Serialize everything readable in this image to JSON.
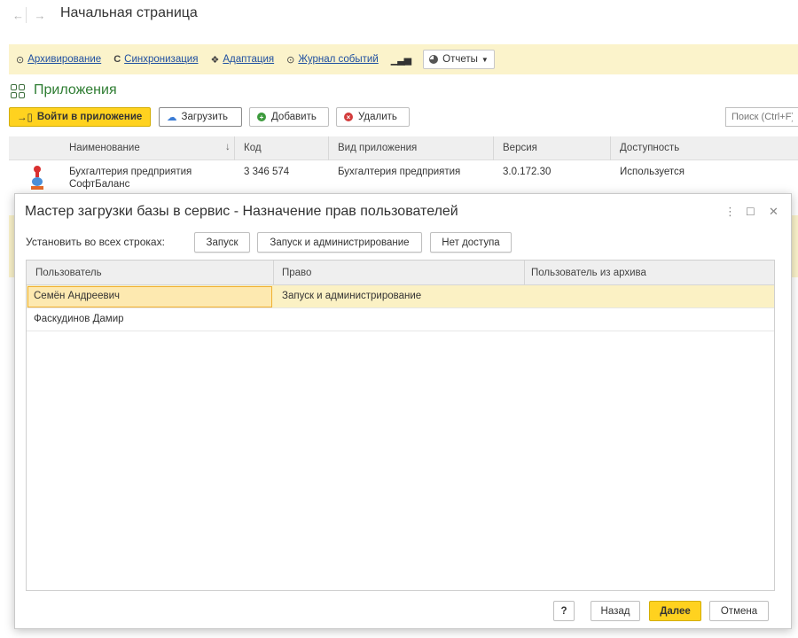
{
  "window": {
    "title": "Начальная страница"
  },
  "commands": [
    {
      "icon": "clock-icon",
      "glyph": "⊙",
      "label": "Архивирование"
    },
    {
      "icon": "refresh-icon",
      "glyph": "C",
      "label": "Синхронизация"
    },
    {
      "icon": "puzzle-icon",
      "glyph": "❖",
      "label": "Адаптация"
    },
    {
      "icon": "history-icon",
      "glyph": "⊙",
      "label": "Журнал событий"
    }
  ],
  "reports": {
    "label": "Отчеты"
  },
  "section": {
    "title": "Приложения"
  },
  "toolbar": {
    "login": "Войти в приложение",
    "upload": "Загрузить",
    "add": "Добавить",
    "delete": "Удалить",
    "search_placeholder": "Поиск (Ctrl+F)"
  },
  "apps_table": {
    "columns": [
      "Наименование",
      "Код",
      "Вид приложения",
      "Версия",
      "Доступность"
    ],
    "rows": [
      {
        "name_line1": "Бухгалтерия предприятия",
        "name_line2": "СофтБаланс",
        "code": "3 346 574",
        "kind": "Бухгалтерия предприятия",
        "version": "3.0.172.30",
        "availability": "Используется"
      }
    ]
  },
  "modal": {
    "title": "Мастер загрузки базы в сервис - Назначение прав пользователей",
    "set_all_label": "Установить во всех строках:",
    "set_buttons": [
      "Запуск",
      "Запуск и администрирование",
      "Нет доступа"
    ],
    "columns": [
      "Пользователь",
      "Право",
      "Пользователь из архива"
    ],
    "rows": [
      {
        "user": "Семён Андреевич",
        "right": "Запуск и администрирование",
        "archive_user": ""
      },
      {
        "user": "Фаскудинов Дамир",
        "right": "",
        "archive_user": ""
      }
    ],
    "footer": {
      "help": "?",
      "back": "Назад",
      "next": "Далее",
      "cancel": "Отмена"
    }
  }
}
